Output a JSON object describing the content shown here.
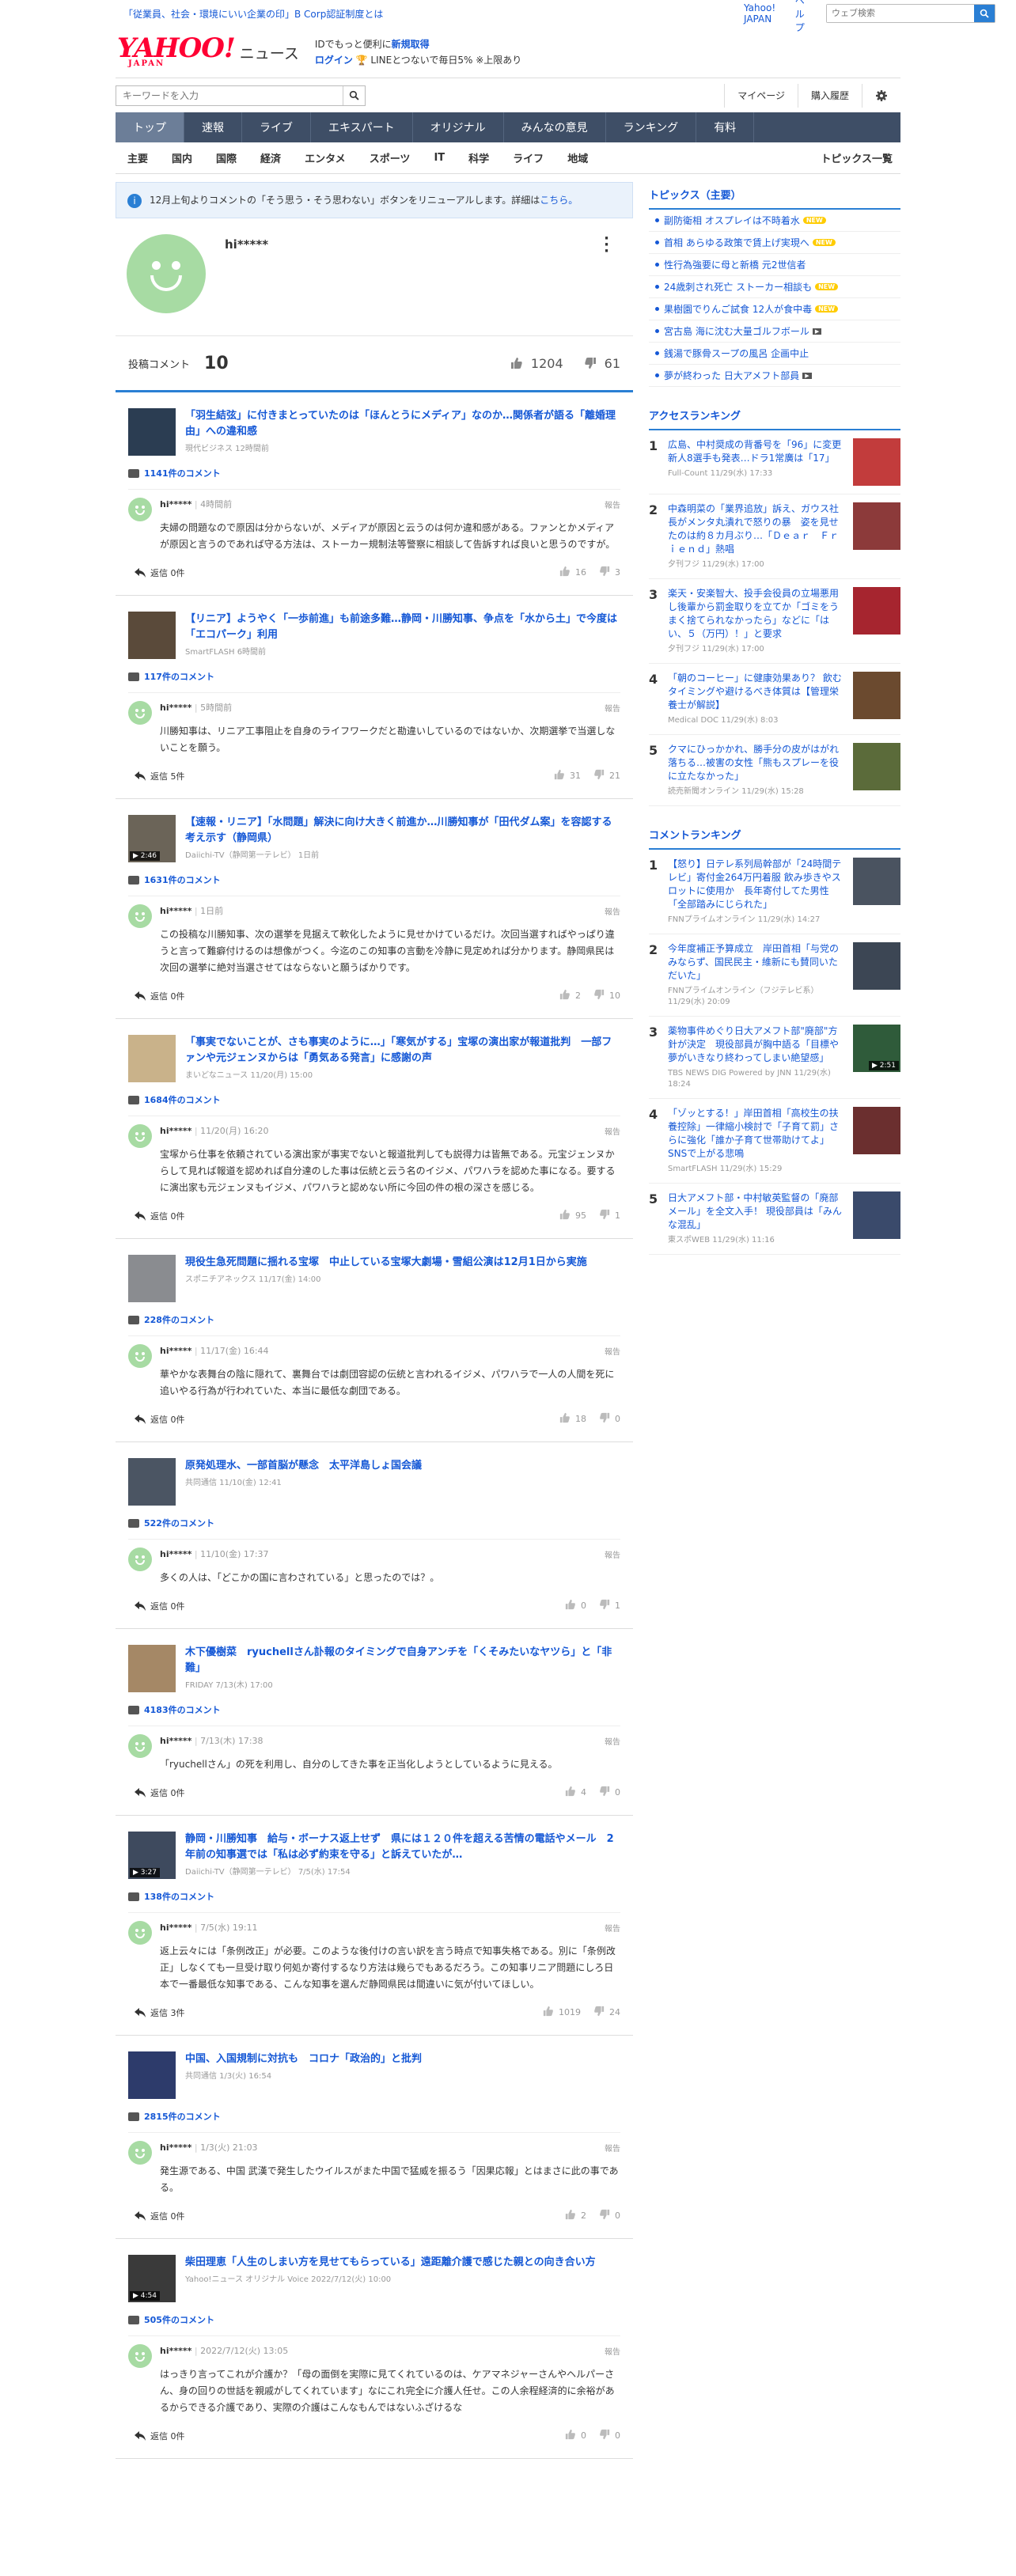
{
  "topbar": {
    "promo": "「従業員、社会・環境にいい企業の印」B Corp認証制度とは",
    "yahoo_japan": "Yahoo! JAPAN",
    "help": "ヘルプ",
    "search_placeholder": "ウェブ検索"
  },
  "header": {
    "logo": "YAHOO!",
    "logo_sub": "JAPAN",
    "news": "ニュース",
    "line1_pre": "IDでもっと便利に",
    "line1_link": "新規取得",
    "login": "ログイン",
    "line2": "🏆 LINEとつないで毎日5% ※上限あり"
  },
  "bar2": {
    "keyword_placeholder": "キーワードを入力",
    "mypage": "マイページ",
    "history": "購入履歴"
  },
  "mainnav": [
    "トップ",
    "速報",
    "ライブ",
    "エキスパート",
    "オリジナル",
    "みんなの意見",
    "ランキング",
    "有料"
  ],
  "subnav": [
    "主要",
    "国内",
    "国際",
    "経済",
    "エンタメ",
    "スポーツ",
    "IT",
    "科学",
    "ライフ",
    "地域"
  ],
  "subnav_last": "トピックス一覧",
  "notice": {
    "text": "12月上旬よりコメントの「そう思う・そう思わない」ボタンをリニューアルします。詳細は",
    "link": "こちら。"
  },
  "profile": {
    "name": "hi*****",
    "comment_label": "投稿コメント",
    "comment_count": "10",
    "likes": "1204",
    "dislikes": "61"
  },
  "articles": [
    {
      "title": "「羽生結弦」に付きまとっていたのは「ほんとうにメディア」なのか…関係者が語る「離婚理由」への違和感",
      "source": "現代ビジネス 12時間前",
      "img": "#2b3d52",
      "dur": "",
      "count": "1141件のコメント",
      "user": "hi*****",
      "time": "4時間前",
      "text": "夫婦の問題なので原因は分からないが、メディアが原因と云うのは何か違和感がある。ファンとかメディアが原因と言うのであれば守る方法は、ストーカー規制法等警察に相談して告訴すれば良いと思うのですが。",
      "reply": "返信 0件",
      "up": "16",
      "down": "3"
    },
    {
      "title": "【リニア】ようやく「一歩前進」も前途多難…静岡・川勝知事、争点を「水から土」で今度は「エコパーク」利用",
      "source": "SmartFLASH 6時間前",
      "img": "#5a4a3a",
      "dur": "",
      "count": "117件のコメント",
      "user": "hi*****",
      "time": "5時間前",
      "text": "川勝知事は、リニア工事阻止を自身のライフワークだと勘違いしているのではないか、次期選挙で当選しないことを願う。",
      "reply": "返信 5件",
      "up": "31",
      "down": "21"
    },
    {
      "title": "【速報・リニア】「水問題」解決に向け大きく前進か…川勝知事が「田代ダム案」を容認する考え示す（静岡県）",
      "source": "Daiichi-TV（静岡第一テレビ） 1日前",
      "img": "#6b6458",
      "dur": "▶ 2:46",
      "count": "1631件のコメント",
      "user": "hi*****",
      "time": "1日前",
      "text": "この投稿な川勝知事、次の選挙を見据えて軟化したように見せかけているだけ。次回当選すればやっぱり違うと言って難癖付けるのは想像がつく。今迄のこの知事の言動を冷静に見定めれば分かります。静岡県民は次回の選挙に絶対当選させてはならないと願うばかりです。",
      "reply": "返信 0件",
      "up": "2",
      "down": "10"
    },
    {
      "title": "「事実でないことが、さも事実のように…」「寒気がする」宝塚の演出家が報道批判　一部ファンや元ジェンヌからは「勇気ある発言」に感謝の声",
      "source": "まいどなニュース 11/20(月) 15:00",
      "img": "#c9b28a",
      "dur": "",
      "count": "1684件のコメント",
      "user": "hi*****",
      "time": "11/20(月) 16:20",
      "text": "宝塚から仕事を依頼されている演出家が事実でないと報道批判しても説得力は皆無である。元宝ジェンヌからして見れば報道を認めれば自分達のした事は伝統と云う名のイジメ、パワハラを認めた事になる。要するに演出家も元ジェンヌもイジメ、パワハラと認めない所に今回の件の根の深さを感じる。",
      "reply": "返信 0件",
      "up": "95",
      "down": "1"
    },
    {
      "title": "現役生急死問題に揺れる宝塚　中止している宝塚大劇場・雪組公演は12月1日から実施",
      "source": "スポニチアネックス 11/17(金) 14:00",
      "img": "#8a8c90",
      "dur": "",
      "count": "228件のコメント",
      "user": "hi*****",
      "time": "11/17(金) 16:44",
      "text": "華やかな表舞台の陰に隠れて、裏舞台では劇団容認の伝統と言われるイジメ、パワハラで一人の人間を死に追いやる行為が行われていた、本当に最低な劇団である。",
      "reply": "返信 0件",
      "up": "18",
      "down": "0"
    },
    {
      "title": "原発処理水、一部首脳が懸念　太平洋島しょ国会議",
      "source": "共同通信 11/10(金) 12:41",
      "img": "#4b5563",
      "dur": "",
      "count": "522件のコメント",
      "user": "hi*****",
      "time": "11/10(金) 17:37",
      "text": "多くの人は、「どこかの国に言わされている」と思ったのでは？。",
      "reply": "返信 0件",
      "up": "0",
      "down": "1"
    },
    {
      "title": "木下優樹菜　ryuchellさん訃報のタイミングで自身アンチを「くそみたいなヤツら」と「非難」",
      "source": "FRIDAY 7/13(木) 17:00",
      "img": "#a58866",
      "dur": "",
      "count": "4183件のコメント",
      "user": "hi*****",
      "time": "7/13(木) 17:38",
      "text": "「ryuchellさん」の死を利用し、自分のしてきた事を正当化しようとしているように見える。",
      "reply": "返信 0件",
      "up": "4",
      "down": "0"
    },
    {
      "title": "静岡・川勝知事　給与・ボーナス返上せず　県には１２０件を超える苦情の電話やメール　2年前の知事選では「私は必ず約束を守る」と訴えていたが…",
      "source": "Daiichi-TV（静岡第一テレビ） 7/5(水) 17:54",
      "img": "#3e4a5e",
      "dur": "▶ 3:27",
      "count": "138件のコメント",
      "user": "hi*****",
      "time": "7/5(水) 19:11",
      "text": "返上云々には「条例改正」が必要。このような後付けの言い訳を言う時点で知事失格である。別に「条例改正」しなくても一旦受け取り何処か寄付するなり方法は幾らでもあるだろう。この知事リニア問題にしろ日本で一番最低な知事である、こんな知事を選んだ静岡県民は間違いに気が付いてほしい。",
      "reply": "返信 3件",
      "up": "1019",
      "down": "24"
    },
    {
      "title": "中国、入国規制に対抗も　コロナ「政治的」と批判",
      "source": "共同通信 1/3(火) 16:54",
      "img": "#2d3b6b",
      "dur": "",
      "count": "2815件のコメント",
      "user": "hi*****",
      "time": "1/3(火) 21:03",
      "text": "発生源である、中国 武漢で発生したウイルスがまた中国で猛威を振るう「因果応報」とはまさに此の事である。",
      "reply": "返信 0件",
      "up": "2",
      "down": "0"
    },
    {
      "title": "柴田理恵「人生のしまい方を見せてもらっている」遠距離介護で感じた親との向き合い方",
      "source": "Yahoo!ニュース オリジナル Voice 2022/7/12(火) 10:00",
      "img": "#3a3a3a",
      "dur": "▶ 4:54",
      "count": "505件のコメント",
      "user": "hi*****",
      "time": "2022/7/12(火) 13:05",
      "text": "はっきり言ってこれが介護か？「母の面倒を実際に見てくれているのは、ケアマネジャーさんやヘルパーさん、身の回りの世話を親戚がしてくれています」なにこれ完全に介護人任せ。この人余程経済的に余裕があるからできる介護であり、実際の介護はこんなもんではないふざけるな",
      "reply": "返信 0件",
      "up": "0",
      "down": "0"
    }
  ],
  "side": {
    "topics_title": "トピックス（主要）",
    "topics": [
      {
        "t": "副防衛相 オスプレイは不時着水",
        "badge": "NEW"
      },
      {
        "t": "首相 あらゆる政策で賃上げ実現へ",
        "badge": "NEW"
      },
      {
        "t": "性行為強要に母と新橋 元2世信者",
        "badge": ""
      },
      {
        "t": "24歳刺され死亡 ストーカー相談も",
        "badge": "NEW"
      },
      {
        "t": "果樹園でりんご試食 12人が食中毒",
        "badge": "NEW"
      },
      {
        "t": "宮古島 海に沈む大量ゴルフボール",
        "badge": "VIDEO"
      },
      {
        "t": "銭湯で豚骨スープの風呂 企画中止",
        "badge": ""
      },
      {
        "t": "夢が終わった 日大アメフト部員",
        "badge": "VIDEO"
      }
    ],
    "access_title": "アクセスランキング",
    "access": [
      {
        "t": "広島、中村奨成の背番号を「96」に変更　新人8選手も発表…ドラ1常廣は「17」",
        "s": "Full-Count 11/29(水) 17:33",
        "img": "#c23c3c"
      },
      {
        "t": "中森明菜の「業界追放」訴え、ガウス社長がメンタ丸潰れで怒りの暴　姿を見せたのは約８カ月ぶり…「Ｄｅａｒ　Ｆｒｉｅｎｄ」熱唱",
        "s": "夕刊フジ 11/29(水) 17:00",
        "img": "#8c3a3a"
      },
      {
        "t": "楽天・安楽智大、投手会役員の立場悪用し後輩から罰金取りを立てか「ゴミをうまく捨てられなかったら」などに「はい、５（万円）！」と要求",
        "s": "夕刊フジ 11/29(水) 17:00",
        "img": "#a6252f"
      },
      {
        "t": "「朝のコーヒー」に健康効果あり？ 飲むタイミングや避けるべき体質は【管理栄養士が解説】",
        "s": "Medical DOC 11/29(水) 8:03",
        "img": "#6b4a2f"
      },
      {
        "t": "クマにひっかかれ、勝手分の皮がはがれ落ちる…被害の女性「熊もスプレーを役に立たなかった」",
        "s": "読売新聞オンライン 11/29(水) 15:28",
        "img": "#5b6b3a"
      }
    ],
    "comment_title": "コメントランキング",
    "comment": [
      {
        "t": "【怒り】日テレ系列局幹部が「24時間テレビ」寄付金264万円着服 飲み歩きやスロットに使用か　長年寄付してた男性「全部踏みにじられた」",
        "s": "FNNプライムオンライン 11/29(水) 14:27",
        "img": "#4a5360",
        "dur": ""
      },
      {
        "t": "今年度補正予算成立　岸田首相「与党のみならず、国民民主・維新にも賛同いただいた」",
        "s": "FNNプライムオンライン（フジテレビ系） 11/29(水) 20:09",
        "img": "#3c4654",
        "dur": ""
      },
      {
        "t": "薬物事件めぐり日大アメフト部\"廃部\"方針が決定　現役部員が胸中語る「目標や夢がいきなり終わってしまい絶望感」",
        "s": "TBS NEWS DIG Powered by JNN 11/29(水) 18:24",
        "img": "#2f5b3a",
        "dur": "▶ 2:51"
      },
      {
        "t": "「ゾッとする！」岸田首相「高校生の扶養控除」一律縮小検討で「子育て罰」さらに強化「誰か子育て世帯助けてよ」SNSで上がる悲鳴",
        "s": "SmartFLASH 11/29(水) 15:29",
        "img": "#6b2f2f",
        "dur": ""
      },
      {
        "t": "日大アメフト部・中村敏英監督の「廃部メール」を全文入手！ 現役部員は「みんな混乱」",
        "s": "東スポWEB 11/29(水) 11:16",
        "img": "#3a4a6b",
        "dur": ""
      }
    ]
  }
}
